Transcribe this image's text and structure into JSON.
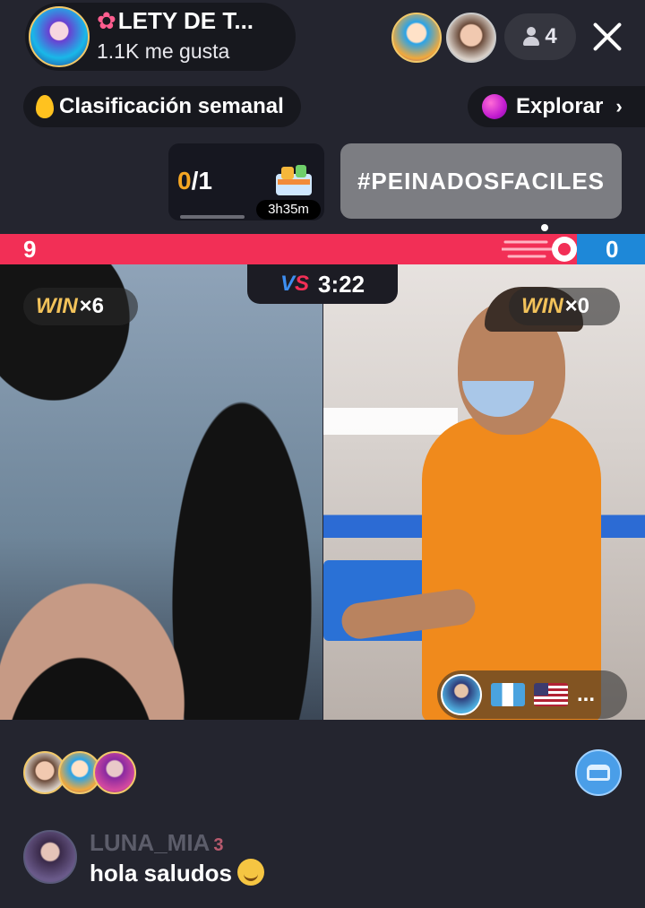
{
  "header": {
    "host_name": "LETY DE T...",
    "host_likes": "1.1K me gusta",
    "viewer_count": "4"
  },
  "pills": {
    "ranking_label": "Clasificación semanal",
    "explore_label": "Explorar"
  },
  "task": {
    "progress_done": "0",
    "progress_total": "/1",
    "timer": "3h35m",
    "hashtag": "#PEINADOSFACILES"
  },
  "battle": {
    "score_left": "9",
    "score_right": "0",
    "timer": "3:22",
    "vs_label_v": "V",
    "vs_label_s": "S",
    "left_win_label": "WIN",
    "left_win_count": "×6",
    "right_win_label": "WIN",
    "right_win_count": "×0",
    "flags_more": "..."
  },
  "chat": {
    "username": "LUNA_MIA",
    "level": "3",
    "message": "hola saludos"
  },
  "colors": {
    "accent_red": "#f22f56",
    "accent_blue": "#1e88d8",
    "win_gold": "#f2c25a",
    "background": "#24252f"
  },
  "icons": [
    "flower-icon",
    "person-icon",
    "close-icon",
    "flame-icon",
    "planet-icon",
    "chevron-right-icon",
    "gift-icon",
    "vs-icon",
    "guatemala-flag-icon",
    "usa-flag-icon",
    "sofa-icon",
    "smile-emoji-icon"
  ]
}
